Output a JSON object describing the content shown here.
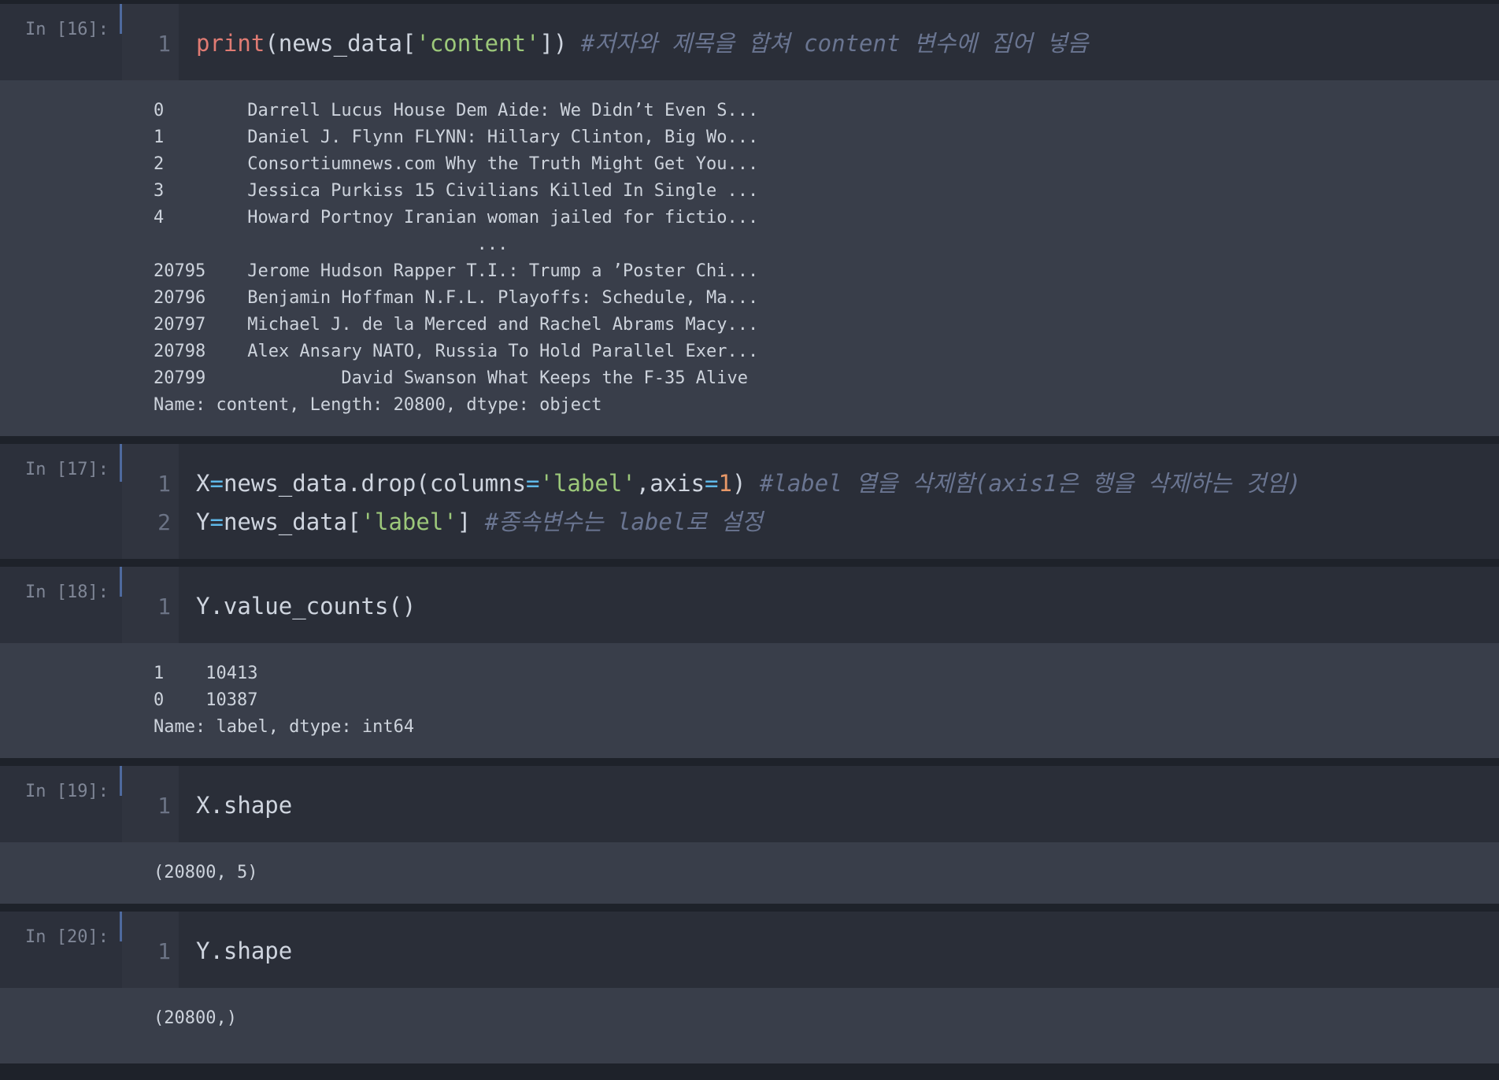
{
  "cells": {
    "c16": {
      "prompt": "In [16]:",
      "line_numbers": [
        "1"
      ],
      "code": {
        "fn": "print",
        "p1": "(news_data[",
        "str": "'content'",
        "p2": "]) ",
        "comment": "#저자와 제목을 합쳐 content 변수에 집어 넣음"
      },
      "output": [
        "0        Darrell Lucus House Dem Aide: We Didn’t Even S...",
        "1        Daniel J. Flynn FLYNN: Hillary Clinton, Big Wo...",
        "2        Consortiumnews.com Why the Truth Might Get You...",
        "3        Jessica Purkiss 15 Civilians Killed In Single ...",
        "4        Howard Portnoy Iranian woman jailed for fictio...",
        "                               ...",
        "20795    Jerome Hudson Rapper T.I.: Trump a ’Poster Chi...",
        "20796    Benjamin Hoffman N.F.L. Playoffs: Schedule, Ma...",
        "20797    Michael J. de la Merced and Rachel Abrams Macy...",
        "20798    Alex Ansary NATO, Russia To Hold Parallel Exer...",
        "20799             David Swanson What Keeps the F-35 Alive",
        "Name: content, Length: 20800, dtype: object"
      ]
    },
    "c17": {
      "prompt": "In [17]:",
      "line_numbers": [
        "1",
        "2"
      ],
      "line1": {
        "a": "X",
        "eq": "=",
        "b": "news_data.drop(columns",
        "eq2": "=",
        "str": "'label'",
        "c": ",axis",
        "eq3": "=",
        "num": "1",
        "d": ") ",
        "comment": "#label 열을 삭제함(axis1은 행을 삭제하는 것임)"
      },
      "line2": {
        "a": "Y",
        "eq": "=",
        "b": "news_data[",
        "str": "'label'",
        "c": "] ",
        "comment": "#종속변수는 label로 설정"
      }
    },
    "c18": {
      "prompt": "In [18]:",
      "line_numbers": [
        "1"
      ],
      "code": "Y.value_counts()",
      "output": [
        "1    10413",
        "0    10387",
        "Name: label, dtype: int64"
      ]
    },
    "c19": {
      "prompt": "In [19]:",
      "line_numbers": [
        "1"
      ],
      "code": "X.shape",
      "output": [
        "(20800, 5)"
      ]
    },
    "c20": {
      "prompt": "In [20]:",
      "line_numbers": [
        "1"
      ],
      "code": "Y.shape",
      "output": [
        "(20800,)"
      ]
    }
  }
}
